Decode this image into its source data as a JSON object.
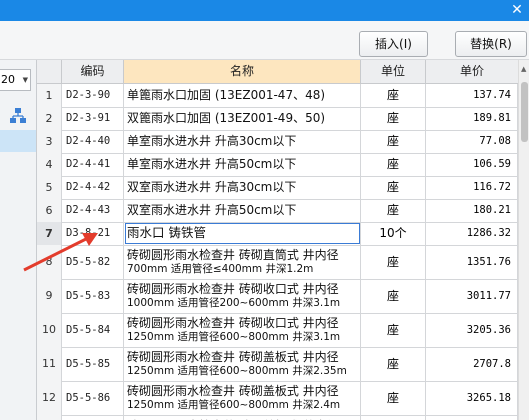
{
  "toolbar": {
    "insert_label": "插入(I)",
    "replace_label": "替换(R)"
  },
  "left_panel": {
    "combo_value": "20"
  },
  "table": {
    "headers": {
      "code": "编码",
      "name": "名称",
      "unit": "单位",
      "price": "单价"
    },
    "rows": [
      {
        "idx": "1",
        "code": "D2-3-90",
        "name": [
          "单篦雨水口加固 (13EZ001-47、48)"
        ],
        "unit": "座",
        "price": "137.74"
      },
      {
        "idx": "2",
        "code": "D2-3-91",
        "name": [
          "双篦雨水口加固 (13EZ001-49、50)"
        ],
        "unit": "座",
        "price": "189.81"
      },
      {
        "idx": "3",
        "code": "D2-4-40",
        "name": [
          "单室雨水进水井 升高30cm以下"
        ],
        "unit": "座",
        "price": "77.08"
      },
      {
        "idx": "4",
        "code": "D2-4-41",
        "name": [
          "单室雨水进水井 升高50cm以下"
        ],
        "unit": "座",
        "price": "106.59"
      },
      {
        "idx": "5",
        "code": "D2-4-42",
        "name": [
          "双室雨水进水井 升高30cm以下"
        ],
        "unit": "座",
        "price": "116.72"
      },
      {
        "idx": "6",
        "code": "D2-4-43",
        "name": [
          "双室雨水进水井 升高50cm以下"
        ],
        "unit": "座",
        "price": "180.21"
      },
      {
        "idx": "7",
        "code": "D3-8-21",
        "name": [
          "雨水口 铸铁管"
        ],
        "unit": "10个",
        "price": "1286.32"
      },
      {
        "idx": "8",
        "code": "D5-5-82",
        "name": [
          "砖砌圆形雨水检查井 砖砌直筒式 井内径",
          "700mm 适用管径≤400mm 井深1.2m"
        ],
        "unit": "座",
        "price": "1351.76"
      },
      {
        "idx": "9",
        "code": "D5-5-83",
        "name": [
          "砖砌圆形雨水检查井 砖砌收口式 井内径",
          "1000mm 适用管径200~600mm 井深3.1m"
        ],
        "unit": "座",
        "price": "3011.77"
      },
      {
        "idx": "10",
        "code": "D5-5-84",
        "name": [
          "砖砌圆形雨水检查井 砖砌收口式 井内径",
          "1250mm 适用管径600~800mm 井深3.1m"
        ],
        "unit": "座",
        "price": "3205.36"
      },
      {
        "idx": "11",
        "code": "D5-5-85",
        "name": [
          "砖砌圆形雨水检查井 砖砌盖板式 井内径",
          "1250mm 适用管径600~800mm 井深2.35m"
        ],
        "unit": "座",
        "price": "2707.8"
      },
      {
        "idx": "12",
        "code": "D5-5-86",
        "name": [
          "砖砌圆形雨水检查井 砖砌盖板式 井内径",
          "1250mm 适用管径600~800mm 井深2.4m"
        ],
        "unit": "座",
        "price": "3265.18"
      },
      {
        "idx": "",
        "code": "",
        "name": [
          "砖砌圆形雨水检查井 砖砌盖板式 井内径"
        ],
        "unit": "",
        "price": ""
      }
    ]
  },
  "colors": {
    "titlebar": "#1a88e6",
    "name_header": "#fde6bf",
    "annotation_arrow": "#e33c2c",
    "selection": "#cce4f7"
  }
}
